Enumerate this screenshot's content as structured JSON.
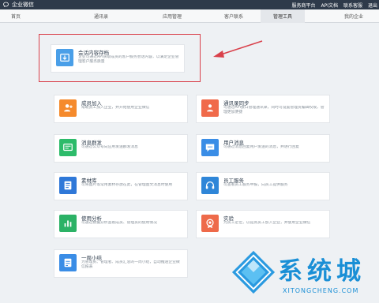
{
  "app": {
    "title": "企业微信",
    "logo_icon": "wework-logo-icon"
  },
  "top_links": [
    "服务商平台",
    "API文档",
    "联系客服",
    "退出"
  ],
  "nav": {
    "tabs": [
      {
        "label": "首页",
        "active": false
      },
      {
        "label": "通讯录",
        "active": false
      },
      {
        "label": "应用管理",
        "active": false
      },
      {
        "label": "客户联系",
        "active": false
      },
      {
        "label": "管理工具",
        "active": true
      },
      {
        "label": "我的企业",
        "active": false
      }
    ]
  },
  "featured": {
    "title": "会话内容存档",
    "desc": "企业可通过API获取成员的客户服务会话内容，以满足企业管理客户服务质量",
    "icon": "archive-icon",
    "color": "#4a9fe8"
  },
  "tools": [
    {
      "title": "成员加入",
      "desc": "帮助员工加入企业，并开始使用企业微信",
      "icon": "user-add-icon",
      "color": "#f58a2c"
    },
    {
      "title": "通讯录同步",
      "desc": "可通过API接口管理通讯录，同时可设置管理员编辑权限，管理更加便捷",
      "icon": "sync-icon",
      "color": "#f06a4a"
    },
    {
      "title": "消息群发",
      "desc": "可通过公众号向应用发送群发消息",
      "icon": "broadcast-icon",
      "color": "#2dbb6a"
    },
    {
      "title": "用户消息",
      "desc": "可通过消息回复用户发送的消息，并进行回复",
      "icon": "message-icon",
      "color": "#3a8de6"
    },
    {
      "title": "素材库",
      "desc": "可将图片等常用素材存放在此，在管理图文消息时使用",
      "icon": "library-icon",
      "color": "#2f78d8"
    },
    {
      "title": "员工服务",
      "desc": "可查看员工服务申报，向员工提供服务",
      "icon": "headset-icon",
      "color": "#2f86d8"
    },
    {
      "title": "使用分析",
      "desc": "可通过数据分析查看成员、管理员的使用情况",
      "icon": "chart-icon",
      "color": "#2cb266"
    },
    {
      "title": "实验",
      "desc": "为员工定位，以提高员工加入企业，并使用企业微信",
      "icon": "badge-icon",
      "color": "#ee6a4a"
    },
    {
      "title": "一周小结",
      "desc": "为管理员、管理者、成员汇总的一周小结，自动推送企业微信报表",
      "icon": "report-icon",
      "color": "#3a8de6"
    }
  ],
  "watermark": {
    "text": "系统城",
    "domain": "XITONGCHENG.COM",
    "icon": "watermark-logo-icon"
  }
}
